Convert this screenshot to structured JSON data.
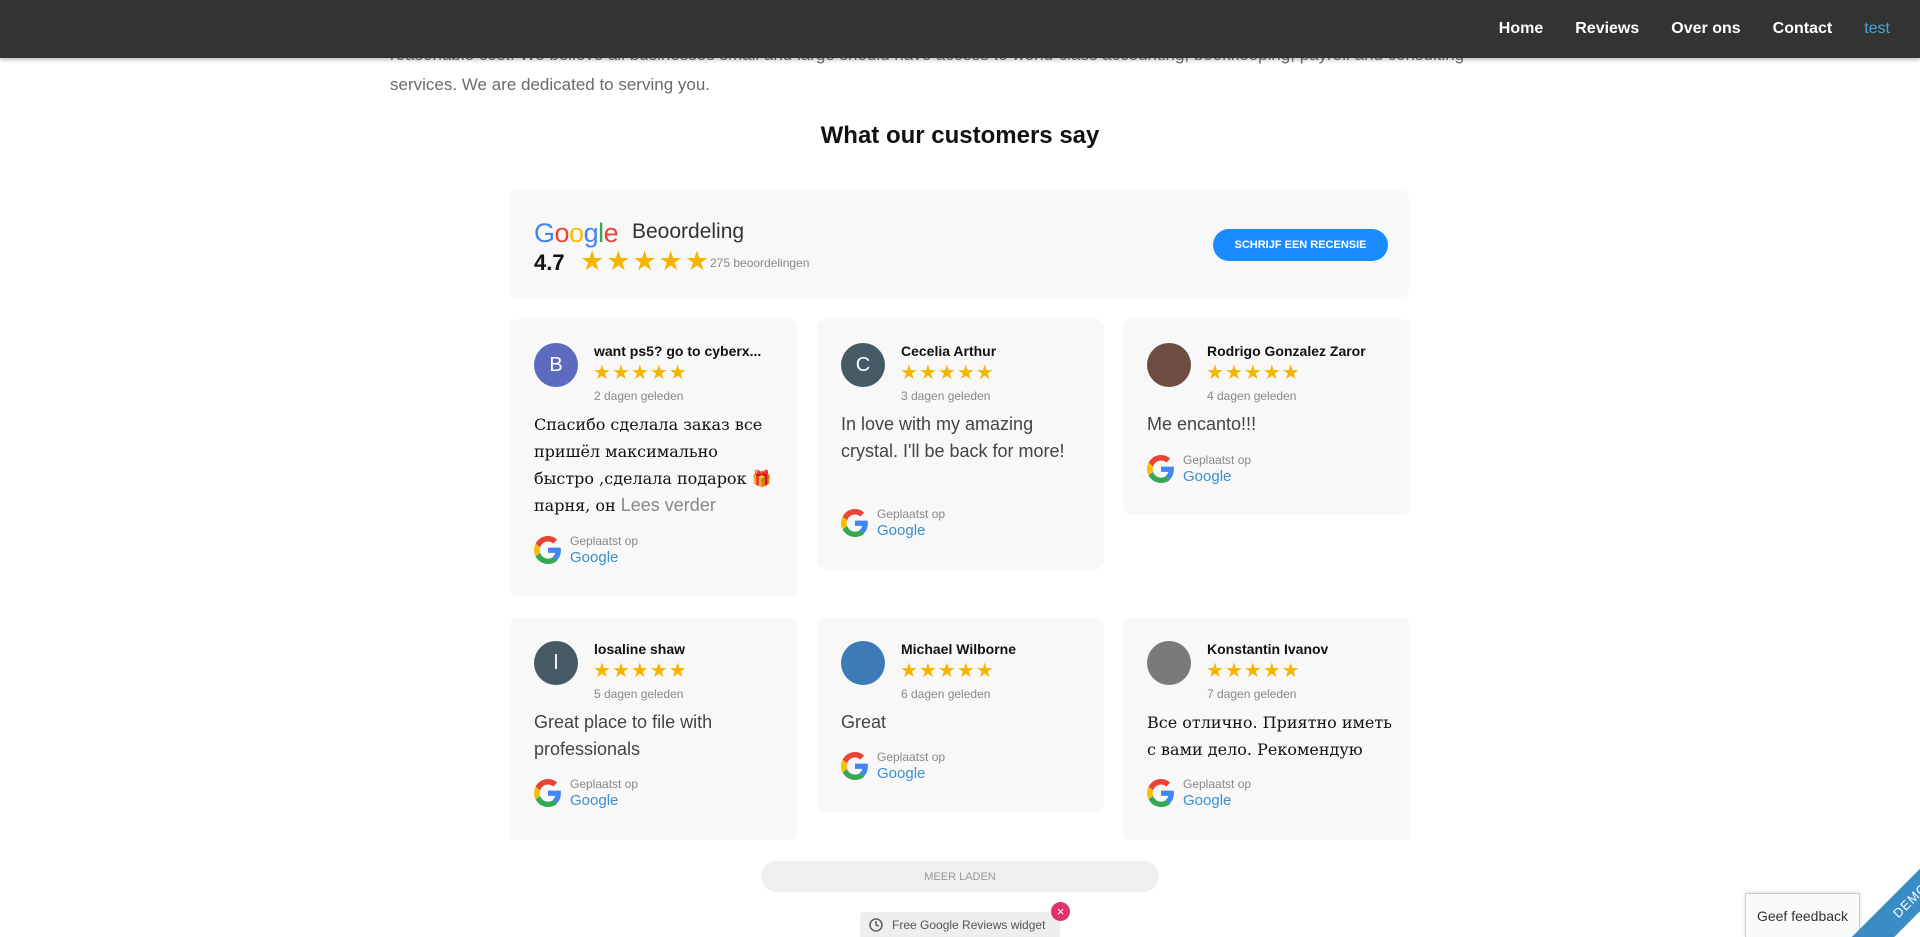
{
  "nav": {
    "items": [
      {
        "label": "Home"
      },
      {
        "label": "Reviews"
      },
      {
        "label": "Over ons"
      },
      {
        "label": "Contact"
      },
      {
        "label": "test"
      }
    ]
  },
  "intro": {
    "line1": "reasonable cost. We believe all businesses small and large should have access to world-class accounting, bookkeeping, payroll and consulting",
    "line2": "services. We are dedicated to serving you."
  },
  "section_title": "What our customers say",
  "summary": {
    "brand": "Google",
    "label": "Beoordeling",
    "rating": "4.7",
    "review_count": "275 beoordelingen",
    "write_button": "Schrijf een recensie",
    "star_color": "#f5b400",
    "button_color": "#1a8cff"
  },
  "reviews": [
    {
      "name": "want ps5? go to cyberx...",
      "initial": "B",
      "avatar_color": "#5c6bc0",
      "date": "2 dagen geleden",
      "text": "Спасибо сделала заказ все пришёл максимально быстро ,сделала подарок 🎁 парня, он",
      "read_more": "Lees verder",
      "posted_label": "Geplaatst op",
      "source": "Google",
      "stars": 5
    },
    {
      "name": "Cecelia Arthur",
      "initial": "C",
      "avatar_color": "#455a64",
      "date": "3 dagen geleden",
      "text": "In love with my amazing crystal. I'll be back for more!",
      "posted_label": "Geplaatst op",
      "source": "Google",
      "stars": 5
    },
    {
      "name": "Rodrigo Gonzalez Zaror",
      "initial": "",
      "avatar_color": "#6d4c41",
      "date": "4 dagen geleden",
      "text": "Me encanto!!!",
      "posted_label": "Geplaatst op",
      "source": "Google",
      "stars": 5
    },
    {
      "name": "losaline shaw",
      "initial": "l",
      "avatar_color": "#455a64",
      "date": "5 dagen geleden",
      "text": "Great place to file with professionals",
      "posted_label": "Geplaatst op",
      "source": "Google",
      "stars": 5
    },
    {
      "name": "Michael Wilborne",
      "initial": "",
      "avatar_color": "#3d7ab8",
      "date": "6 dagen geleden",
      "text": "Great",
      "posted_label": "Geplaatst op",
      "source": "Google",
      "stars": 5
    },
    {
      "name": "Konstantin Ivanov",
      "initial": "",
      "avatar_color": "#7a7a7a",
      "date": "7 dagen geleden",
      "text": "Все отлично. Приятно иметь с вами дело. Рекомендую",
      "posted_label": "Geplaatst op",
      "source": "Google",
      "stars": 5
    }
  ],
  "load_more": "MEER LADEN",
  "widget_badge": {
    "label": "Free Google Reviews widget",
    "close": "×",
    "icon": "refresh-icon"
  },
  "feedback": "Geef feedback",
  "demo_ribbon": "DEMO"
}
